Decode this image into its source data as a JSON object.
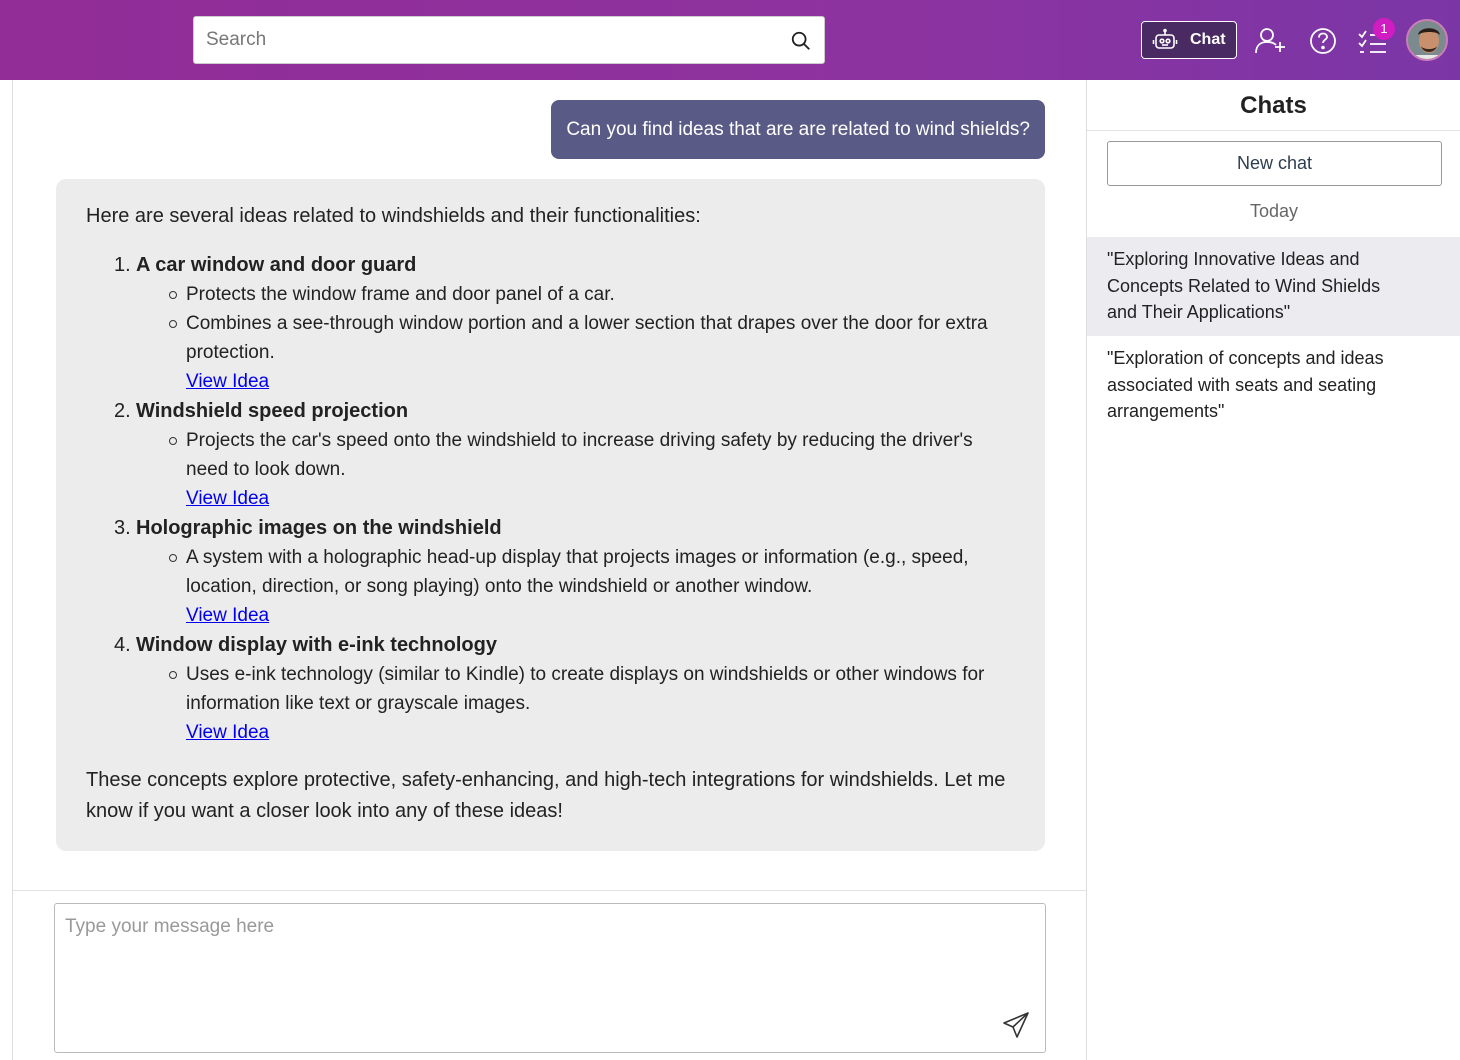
{
  "header": {
    "search_placeholder": "Search",
    "chat_button_label": "Chat",
    "notification_count": "1",
    "icons": [
      "search-icon",
      "robot-icon",
      "add-user-icon",
      "help-icon",
      "task-list-icon",
      "avatar"
    ]
  },
  "conversation": {
    "user_message": "Can you find ideas that are are related to wind shields?",
    "bot_intro": "Here are several ideas related to windshields and their functionalities:",
    "ideas": [
      {
        "number": "1.",
        "title": "A car window and door guard",
        "points": [
          "Protects the window frame and door panel of a car.",
          "Combines a see-through window portion and a lower section that drapes over the door for extra protection."
        ],
        "link": "View Idea"
      },
      {
        "number": "2.",
        "title": "Windshield speed projection",
        "points": [
          "Projects the car's speed onto the windshield to increase driving safety by reducing the driver's need to look down."
        ],
        "link": "View Idea"
      },
      {
        "number": "3.",
        "title": "Holographic images on the windshield",
        "points": [
          "A system with a holographic head-up display that projects images or information (e.g., speed, location, direction, or song playing) onto the windshield or another window."
        ],
        "link": "View Idea"
      },
      {
        "number": "4.",
        "title": "Window display with e-ink technology",
        "points": [
          "Uses e-ink technology (similar to Kindle) to create displays on windshields or other windows for information like text or grayscale images."
        ],
        "link": "View Idea"
      }
    ],
    "bot_outro": "These concepts explore protective, safety-enhancing, and high-tech integrations for windshields. Let me know if you want a closer look into any of these ideas!"
  },
  "composer": {
    "placeholder": "Type your message here"
  },
  "sidebar": {
    "title": "Chats",
    "new_chat_label": "New chat",
    "section_label": "Today",
    "chats": [
      {
        "title": "\"Exploring Innovative Ideas and Concepts Related to Wind Shields and Their Applications\"",
        "active": true
      },
      {
        "title": "\"Exploration of concepts and ideas associated with seats and seating arrangements\"",
        "active": false
      }
    ]
  },
  "colors": {
    "header_gradient_start": "#922c96",
    "header_gradient_end": "#7b36a6",
    "user_bubble": "#5a5a86",
    "bot_bubble": "#ececec",
    "link": "#0000ee",
    "badge": "#d11cc1"
  }
}
